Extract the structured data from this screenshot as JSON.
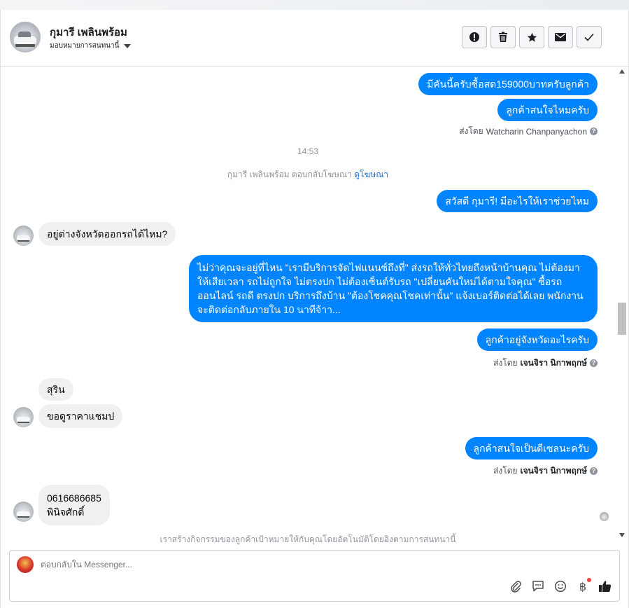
{
  "header": {
    "contact_name": "กุมารี เพลินพร้อม",
    "assign_label": "มอบหมายการสนทนานี้"
  },
  "actions": [
    {
      "name": "mark-spam-button",
      "icon": "alert-icon"
    },
    {
      "name": "delete-button",
      "icon": "trash-icon"
    },
    {
      "name": "star-button",
      "icon": "star-icon"
    },
    {
      "name": "mark-unread-button",
      "icon": "envelope-icon"
    },
    {
      "name": "mark-done-button",
      "icon": "check-icon"
    }
  ],
  "messages": {
    "out1": "มีคันนี้ครับซื้อสด159000บาทครับลูกค้า",
    "out2": "ลูกค้าสนใจไหมครับ",
    "sent1_prefix": "ส่งโดย",
    "sent1_name": "Watcharin Chanpanyachon",
    "time": "14:53",
    "ad_reply_text": "กุมารี เพลินพร้อม ตอบกลับโฆษณา",
    "ad_reply_link": "ดูโฆษณา",
    "out3": "สวัสดี กุมารี! มีอะไรให้เราช่วยไหม",
    "in1": "อยู่ต่างจังหวัดออกรถได้ไหม?",
    "out4": "ไม่ว่าคุณจะอยู่ที่ไหน \"เรามีบริการจัดไฟแนนซ์ถึงที่\"  ส่งรถให้ทั่วไทยถึงหน้าบ้านคุณ ไม่ต้องมาให้เสียเวลา รถไม่ถูกใจ ไม่ตรงปก ไม่ต้องเซ็นต์รับรถ \"เปลี่ยนคันใหม่ได้ตามใจคุณ\" ซื้อรถออนไลน์ รถดี ตรงปก บริการถึงบ้าน \"ต้องโชคคุณโชคเท่านั้น\" แจ้งเบอร์ติดต่อได้เลย พนักงานจะติดต่อกลับภายใน 10 นาทีจ้าา...",
    "out5": "ลูกค้าอยู่จังหวัดอะไรครับ",
    "sent2_prefix": "ส่งโดย",
    "sent2_name": "เจนจิรา นิกาพฤกษ์",
    "in2": "สุริน",
    "in3": "ขอดูราคาแชมป",
    "out6": "ลูกค้าสนใจเป็นดีเซลนะครับ",
    "sent3_prefix": "ส่งโดย",
    "sent3_name": "เจนจิรา นิกาพฤกษ์",
    "in4_line1": "0616686685",
    "in4_line2": "พินิจศักดิ์",
    "activity_note": "เราสร้างกิจกรรมของลูกค้าเป้าหมายให้กับคุณโดยอัตโนมัติโดยอิงตามการสนทนานี้"
  },
  "composer": {
    "placeholder": "ตอบกลับใน Messenger...",
    "baht_symbol": "฿"
  },
  "colors": {
    "outgoing_bubble": "#0084ff",
    "incoming_bubble": "#f1f0f0",
    "link": "#1d6ed8"
  }
}
